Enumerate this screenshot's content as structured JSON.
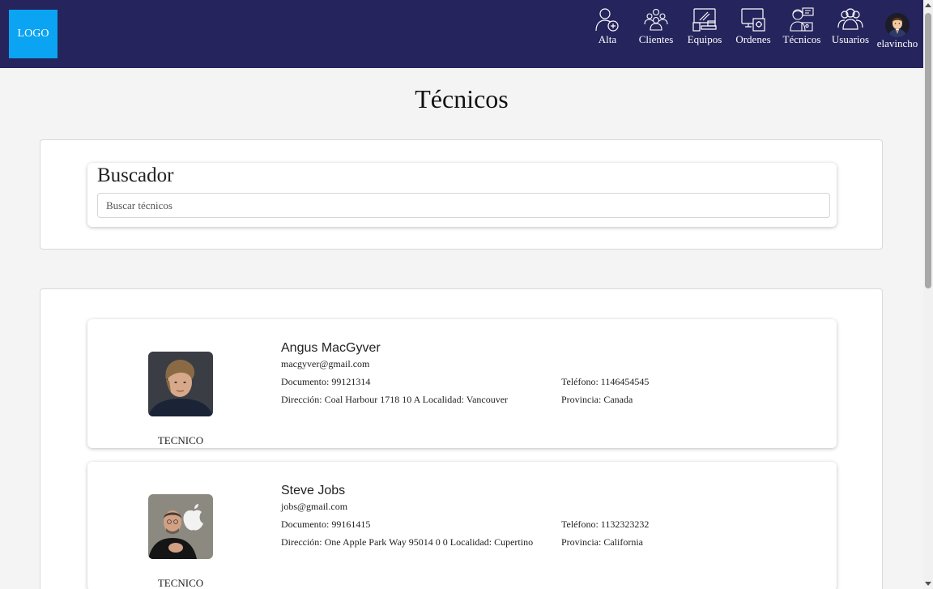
{
  "nav": {
    "logo": "LOGO",
    "items": [
      {
        "label": "Alta",
        "icon": "user-add-icon"
      },
      {
        "label": "Clientes",
        "icon": "clients-group-icon"
      },
      {
        "label": "Equipos",
        "icon": "devices-icon"
      },
      {
        "label": "Ordenes",
        "icon": "orders-icon"
      },
      {
        "label": "Técnicos",
        "icon": "technician-icon"
      },
      {
        "label": "Usuarios",
        "icon": "users-icon"
      }
    ],
    "user": "elavincho"
  },
  "page": {
    "title": "Técnicos"
  },
  "search": {
    "title": "Buscador",
    "placeholder": "Buscar técnicos"
  },
  "technicians": [
    {
      "name": "Angus MacGyver",
      "email": "macgyver@gmail.com",
      "document": "Documento: 99121314",
      "address": "Dirección: Coal Harbour 1718 10 A Localidad: Vancouver",
      "phone": "Teléfono: 1146454545",
      "province": "Provincia: Canada",
      "role": "TECNICO"
    },
    {
      "name": "Steve Jobs",
      "email": "jobs@gmail.com",
      "document": "Documento: 99161415",
      "address": "Dirección: One Apple Park Way 95014 0 0 Localidad: Cupertino",
      "phone": "Teléfono: 1132323232",
      "province": "Provincia: California",
      "role": "TECNICO"
    }
  ],
  "colors": {
    "navbar": "#25245d",
    "logo_bg": "#0aa4f2"
  }
}
